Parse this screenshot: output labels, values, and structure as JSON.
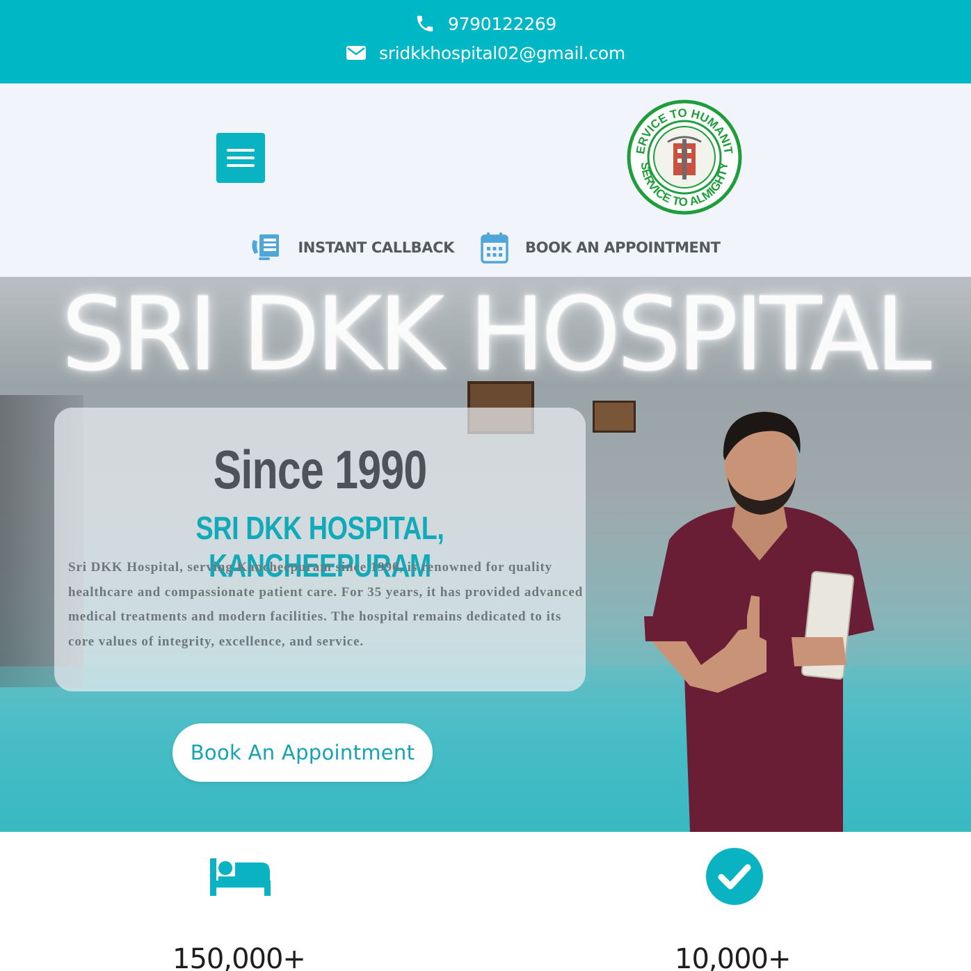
{
  "topbar": {
    "phone": "9790122269",
    "email": "sridkkhospital02@gmail.com",
    "phone_icon": "phone-icon",
    "email_icon": "envelope-icon",
    "bg_color": "#00b7c6"
  },
  "header": {
    "menu_icon": "hamburger-menu-icon",
    "logo_alt": "Sri DKK Hospital seal",
    "logo_top_text": "SERVICE TO HUMANITY",
    "logo_bottom_text": "SERVICE TO ALMIGHTY",
    "quick_links": [
      {
        "label": "INSTANT CALLBACK",
        "icon": "callback-icon"
      },
      {
        "label": "BOOK AN APPOINTMENT",
        "icon": "calendar-icon"
      }
    ]
  },
  "hero": {
    "sign_text": "SRI DKK HOSPITAL",
    "since": "Since 1990",
    "title": "SRI DKK HOSPITAL, KANCHEEPURAM",
    "description": "Sri DKK Hospital, serving Kancheepuram since 1990, is renowned for quality healthcare and compassionate patient care. For 35 years, it has provided advanced medical treatments and modern facilities. The hospital remains dedicated to its core values of integrity, excellence, and service.",
    "cta_label": "Book An Appointment",
    "accent_color": "#12aab8"
  },
  "stats": [
    {
      "icon": "bed-icon",
      "value": "150,000+"
    },
    {
      "icon": "check-circle-icon",
      "value": "10,000+"
    }
  ]
}
